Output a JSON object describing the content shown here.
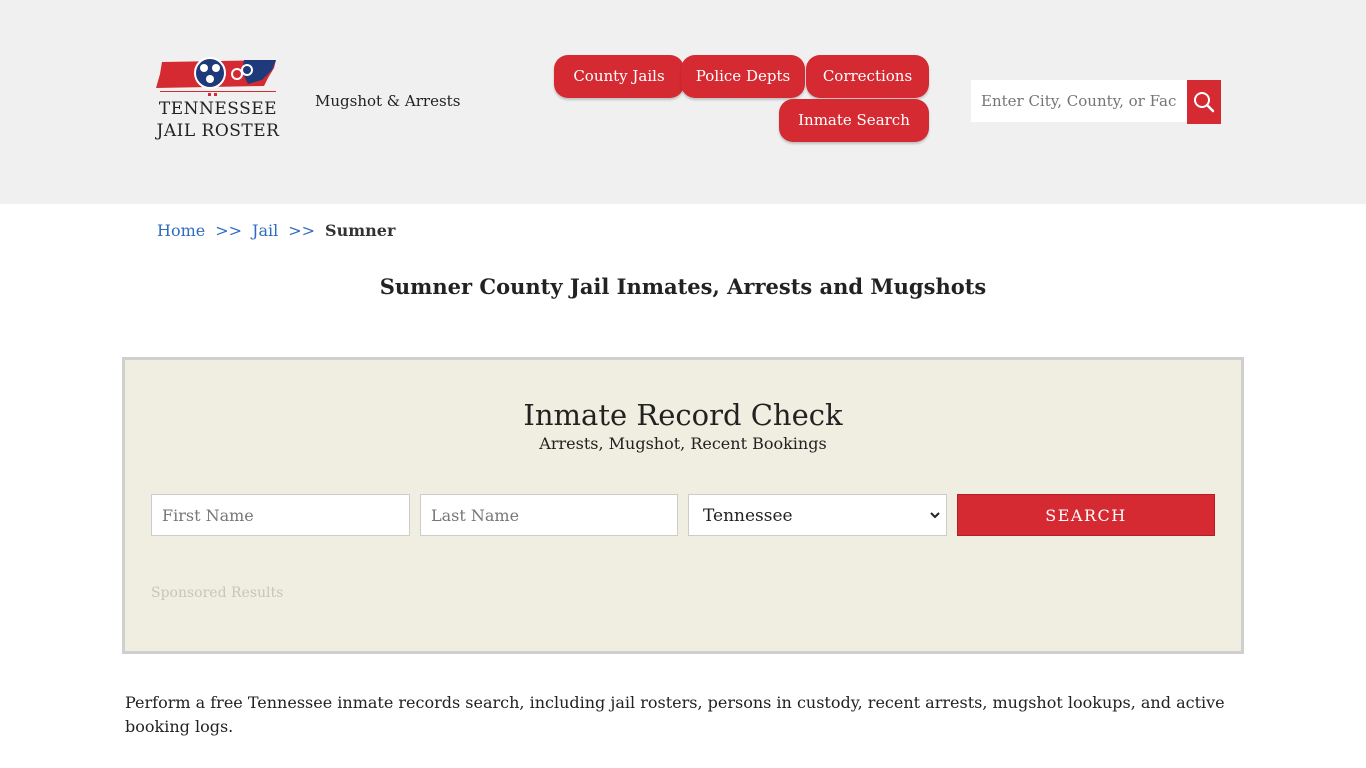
{
  "header": {
    "logo_line1": "TENNESSEE",
    "logo_line2": "JAIL ROSTER",
    "tagline": "Mugshot & Arrests",
    "nav": [
      "County Jails",
      "Police Depts",
      "Corrections",
      "Inmate Search"
    ],
    "search_placeholder": "Enter City, County, or Facility"
  },
  "breadcrumb": {
    "home": "Home",
    "sep": ">>",
    "jail": "Jail",
    "current": "Sumner"
  },
  "page_title": "Sumner County Jail Inmates, Arrests and Mugshots",
  "record_check": {
    "title": "Inmate Record Check",
    "subtitle": "Arrests, Mugshot, Recent Bookings",
    "first_name_placeholder": "First Name",
    "last_name_placeholder": "Last Name",
    "state_selected": "Tennessee",
    "search_label": "SEARCH",
    "sponsored": "Sponsored Results"
  },
  "body": {
    "paragraph1": "Perform a free Tennessee inmate records search, including jail rosters, persons in custody, recent arrests, mugshot lookups, and active booking logs."
  },
  "colors": {
    "accent": "#d52a32",
    "header_bg": "#f0f0f0",
    "panel_bg": "#f0eee0",
    "link": "#2f6bbf"
  }
}
